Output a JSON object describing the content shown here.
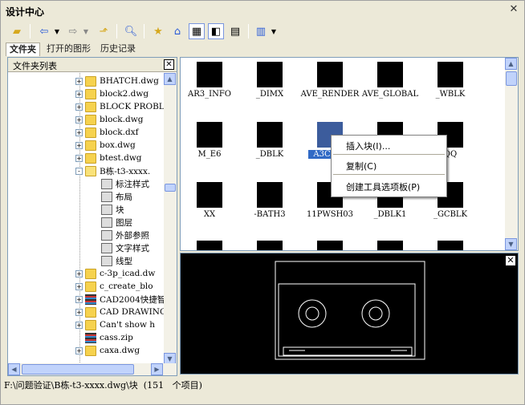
{
  "window": {
    "title": "设计中心",
    "close_glyph": "✕"
  },
  "toolbar": {
    "icons": [
      "folder-open-icon",
      "back-icon",
      "dropdown-icon",
      "forward-icon",
      "dropdown-icon",
      "up-folder-icon",
      "search-icon",
      "favorites-icon",
      "home-icon",
      "tree-toggle-icon",
      "preview-icon",
      "description-icon",
      "views-icon",
      "dropdown-icon"
    ]
  },
  "tabs": [
    {
      "label": "文件夹",
      "active": true
    },
    {
      "label": "打开的图形",
      "active": false
    },
    {
      "label": "历史记录",
      "active": false
    }
  ],
  "folder_panel": {
    "title": "文件夹列表",
    "items": [
      {
        "label": "BHATCH.dwg",
        "kind": "folder",
        "expander": "+"
      },
      {
        "label": "block2.dwg",
        "kind": "folder",
        "expander": "+"
      },
      {
        "label": "BLOCK PROBLEM",
        "kind": "folder",
        "expander": "+"
      },
      {
        "label": "block.dwg",
        "kind": "folder",
        "expander": "+"
      },
      {
        "label": "block.dxf",
        "kind": "dxf",
        "expander": "+"
      },
      {
        "label": "box.dwg",
        "kind": "folder",
        "expander": "+"
      },
      {
        "label": "btest.dwg",
        "kind": "folder",
        "expander": "+"
      },
      {
        "label": "B栋-t3-xxxx.",
        "kind": "folder-open",
        "expander": "-"
      },
      {
        "label": "标注样式",
        "kind": "sub",
        "icon": "dimstyle-icon"
      },
      {
        "label": "布局",
        "kind": "sub",
        "icon": "layout-icon"
      },
      {
        "label": "块",
        "kind": "sub",
        "icon": "block-icon"
      },
      {
        "label": "图层",
        "kind": "sub",
        "icon": "layer-icon"
      },
      {
        "label": "外部参照",
        "kind": "sub",
        "icon": "xref-icon"
      },
      {
        "label": "文字样式",
        "kind": "sub",
        "icon": "textstyle-icon"
      },
      {
        "label": "线型",
        "kind": "sub",
        "icon": "linetype-icon"
      },
      {
        "label": "c-3p_icad.dw",
        "kind": "folder",
        "expander": "+"
      },
      {
        "label": "c_create_blo",
        "kind": "folder",
        "expander": "+"
      },
      {
        "label": "CAD2004快捷智",
        "kind": "stack",
        "expander": "+"
      },
      {
        "label": "CAD DRAWING.",
        "kind": "folder",
        "expander": "+"
      },
      {
        "label": "Can't show h",
        "kind": "folder",
        "expander": "+"
      },
      {
        "label": "cass.zip",
        "kind": "stack",
        "expander": ""
      },
      {
        "label": "caxa.dwg",
        "kind": "folder",
        "expander": "+"
      }
    ]
  },
  "blocks": [
    {
      "label": "AR3_INFO"
    },
    {
      "label": "_DIMX"
    },
    {
      "label": "AVE_RENDER"
    },
    {
      "label": "AVE_GLOBAL"
    },
    {
      "label": "_WBLK"
    },
    {
      "label": "M_E6"
    },
    {
      "label": "_DBLK"
    },
    {
      "label": "A3C5E5",
      "selected": true
    },
    {
      "label": ""
    },
    {
      "label": "QQ"
    },
    {
      "label": "XX"
    },
    {
      "label": "-BATH3"
    },
    {
      "label": "11PWSH03"
    },
    {
      "label": "_DBLK1"
    },
    {
      "label": "_GCBLK"
    }
  ],
  "context_menu": {
    "items": [
      "插入块(I)...",
      "复制(C)",
      "创建工具选项板(P)"
    ]
  },
  "preview": {
    "close_glyph": "✕"
  },
  "status_bar": {
    "text": "F:\\问题验证\\B栋-t3-xxxx.dwg\\块  (151   个项目)"
  }
}
